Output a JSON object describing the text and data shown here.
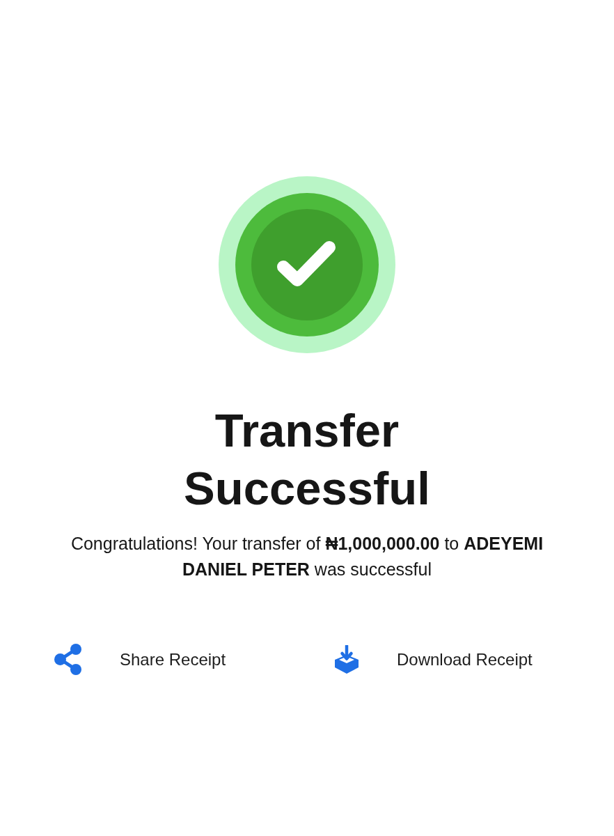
{
  "status": {
    "title": "Transfer Successful",
    "message": "Congratulations! Your transfer of **₦1,000,000.00** to **ADEYEMI DANIEL PETER** was successful"
  },
  "actions": [
    {
      "kind": "share",
      "label": "Share Receipt"
    },
    {
      "kind": "download",
      "label": "Download Receipt"
    }
  ]
}
